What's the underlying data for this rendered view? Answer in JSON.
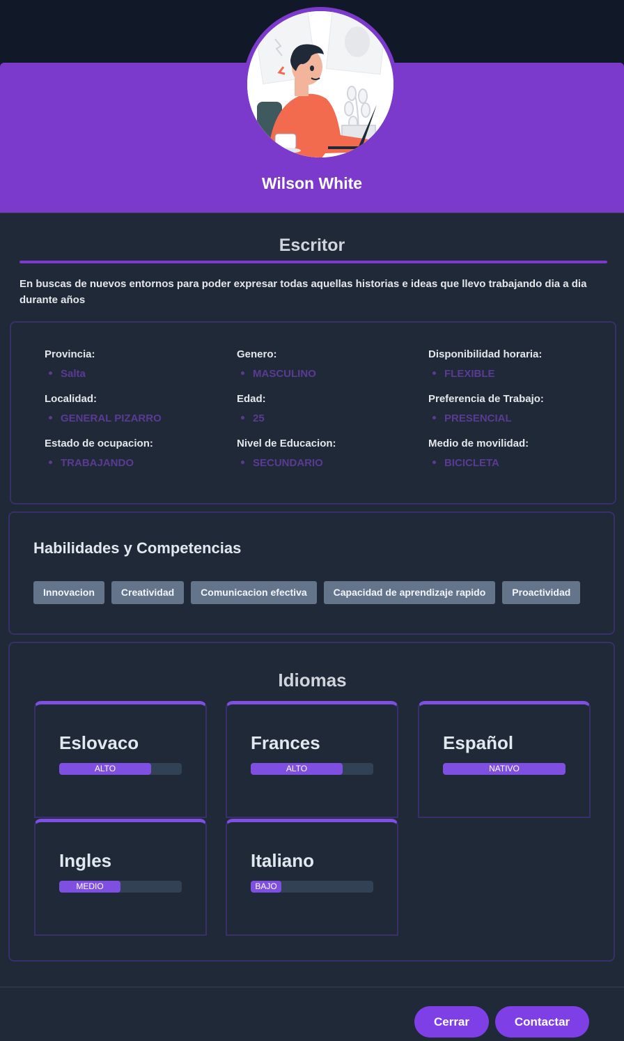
{
  "profile": {
    "name": "Wilson White",
    "job_title": "Escritor",
    "bio": "En buscas de nuevos entornos para poder expresar todas aquellas historias e ideas que llevo trabajando dia a dia durante años"
  },
  "info": {
    "col1": [
      {
        "label": "Provincia:",
        "value": "Salta"
      },
      {
        "label": "Localidad:",
        "value": "GENERAL PIZARRO"
      },
      {
        "label": "Estado de ocupacion:",
        "value": "TRABAJANDO"
      }
    ],
    "col2": [
      {
        "label": "Genero:",
        "value": "MASCULINO"
      },
      {
        "label": "Edad:",
        "value": "25"
      },
      {
        "label": "Nivel de Educacion:",
        "value": "SECUNDARIO"
      }
    ],
    "col3": [
      {
        "label": "Disponibilidad horaria:",
        "value": "FLEXIBLE"
      },
      {
        "label": "Preferencia de Trabajo:",
        "value": "PRESENCIAL"
      },
      {
        "label": "Medio de movilidad:",
        "value": "BICICLETA"
      }
    ]
  },
  "skills": {
    "title": "Habilidades y Competencias",
    "items": [
      "Innovacion",
      "Creatividad",
      "Comunicacion efectiva",
      "Capacidad de aprendizaje rapido",
      "Proactividad"
    ]
  },
  "languages": {
    "title": "Idiomas",
    "items": [
      {
        "name": "Eslovaco",
        "level": "ALTO",
        "fill": 0.75
      },
      {
        "name": "Frances",
        "level": "ALTO",
        "fill": 0.75
      },
      {
        "name": "Español",
        "level": "NATIVO",
        "fill": 1.0
      },
      {
        "name": "Ingles",
        "level": "MEDIO",
        "fill": 0.5
      },
      {
        "name": "Italiano",
        "level": "BAJO",
        "fill": 0.25
      }
    ]
  },
  "actions": {
    "close_label": "Cerrar",
    "contact_label": "Contactar"
  },
  "colors": {
    "accent": "#7b3acc",
    "button": "#7e3fe6",
    "value_text": "#5b3a94",
    "background": "#1f2937"
  }
}
